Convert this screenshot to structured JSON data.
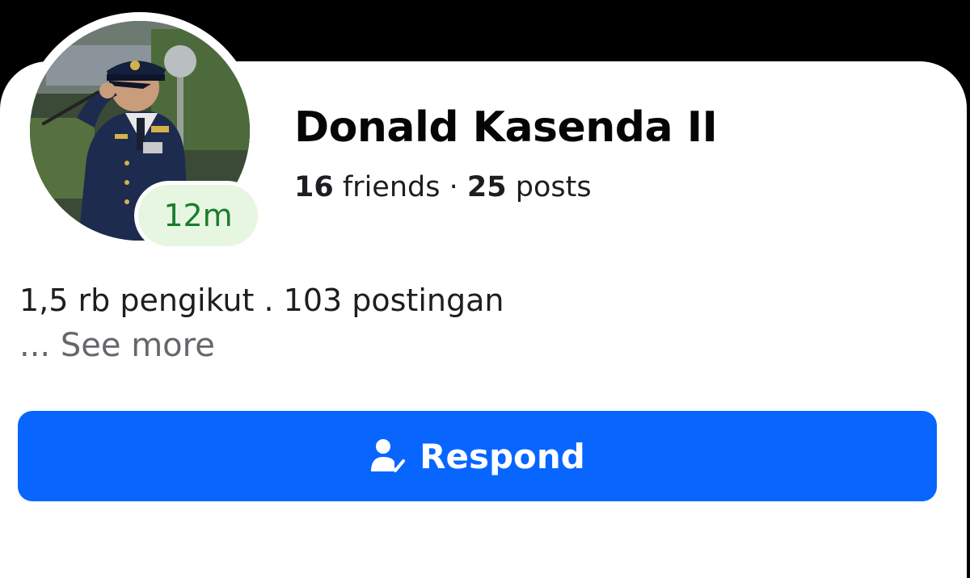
{
  "profile": {
    "name": "Donald Kasenda II",
    "time_badge": "12m",
    "friends_count": "16",
    "friends_label": "friends",
    "separator": "·",
    "posts_count": "25",
    "posts_label": "posts",
    "avatar_icon": "profile-photo"
  },
  "bio": {
    "text": "1,5 rb pengikut . 103 postingan",
    "see_more_prefix": "...",
    "see_more_label": "See more"
  },
  "actions": {
    "respond_label": "Respond",
    "respond_icon": "person-check-icon"
  },
  "colors": {
    "background": "#000000",
    "card": "#ffffff",
    "primary_button": "#0866ff",
    "badge_bg": "#e7f6e1",
    "badge_text": "#1a7d2b",
    "secondary_text": "#65676b"
  }
}
